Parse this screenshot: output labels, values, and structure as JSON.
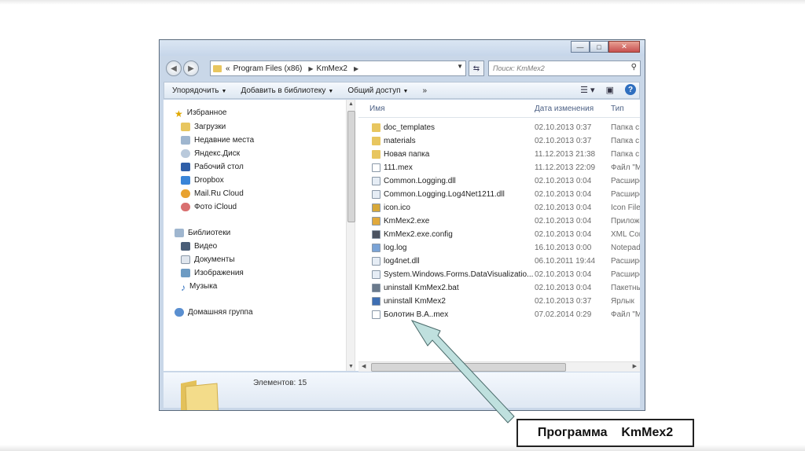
{
  "window": {
    "controls": {
      "minimize": "—",
      "maximize": "□",
      "close": "✕"
    }
  },
  "address": {
    "prefix": "«",
    "segments": [
      "Program Files (x86)",
      "KmMex2"
    ]
  },
  "search": {
    "placeholder": "Поиск: KmMex2"
  },
  "toolbar": {
    "organize": "Упорядочить",
    "add_to_library": "Добавить в библиотеку",
    "share": "Общий доступ",
    "more": "»"
  },
  "nav": {
    "favorites": {
      "label": "Избранное",
      "items": [
        "Загрузки",
        "Недавние места",
        "Яндекс.Диск",
        "Рабочий стол",
        "Dropbox",
        "Mail.Ru Cloud",
        "Фото iCloud"
      ]
    },
    "libraries": {
      "label": "Библиотеки",
      "items": [
        "Видео",
        "Документы",
        "Изображения",
        "Музыка"
      ]
    },
    "homegroup": "Домашняя группа"
  },
  "columns": {
    "name": "Имя",
    "date": "Дата изменения",
    "type": "Тип"
  },
  "files": [
    {
      "name": "doc_templates",
      "date": "02.10.2013 0:37",
      "type": "Папка с ф",
      "icon": "folder-icon"
    },
    {
      "name": "materials",
      "date": "02.10.2013 0:37",
      "type": "Папка с ф",
      "icon": "folder-icon"
    },
    {
      "name": "Новая папка",
      "date": "11.12.2013 21:38",
      "type": "Папка с ф",
      "icon": "folder-icon"
    },
    {
      "name": "111.mex",
      "date": "11.12.2013 22:09",
      "type": "Файл \"МЕ",
      "icon": "file-icon"
    },
    {
      "name": "Common.Logging.dll",
      "date": "02.10.2013 0:04",
      "type": "Расширен",
      "icon": "dll-icon"
    },
    {
      "name": "Common.Logging.Log4Net1211.dll",
      "date": "02.10.2013 0:04",
      "type": "Расширен",
      "icon": "dll-icon"
    },
    {
      "name": "icon.ico",
      "date": "02.10.2013 0:04",
      "type": "Icon File",
      "icon": "ico-icon"
    },
    {
      "name": "KmMex2.exe",
      "date": "02.10.2013 0:04",
      "type": "Приложе",
      "icon": "exe-icon"
    },
    {
      "name": "KmMex2.exe.config",
      "date": "02.10.2013 0:04",
      "type": "XML Conf",
      "icon": "config-icon"
    },
    {
      "name": "log.log",
      "date": "16.10.2013 0:00",
      "type": "Notepad+",
      "icon": "log-icon"
    },
    {
      "name": "log4net.dll",
      "date": "06.10.2011 19:44",
      "type": "Расширен",
      "icon": "dll-icon"
    },
    {
      "name": "System.Windows.Forms.DataVisualizatio...",
      "date": "02.10.2013 0:04",
      "type": "Расширен",
      "icon": "dll-icon"
    },
    {
      "name": "uninstall KmMex2.bat",
      "date": "02.10.2013 0:04",
      "type": "Пакетный",
      "icon": "bat-icon"
    },
    {
      "name": "uninstall KmMex2",
      "date": "02.10.2013 0:37",
      "type": "Ярлык",
      "icon": "shortcut-icon"
    },
    {
      "name": "Болотин В.А..mex",
      "date": "07.02.2014 0:29",
      "type": "Файл \"МЕ",
      "icon": "file-icon"
    }
  ],
  "details": {
    "count_text": "Элементов: 15"
  },
  "callout": {
    "text": "Программа    KmMex2"
  },
  "colors": {
    "folder": "#e8c65f",
    "callout_arrow": "#bfe0de",
    "accent": "#2f6fbf"
  }
}
